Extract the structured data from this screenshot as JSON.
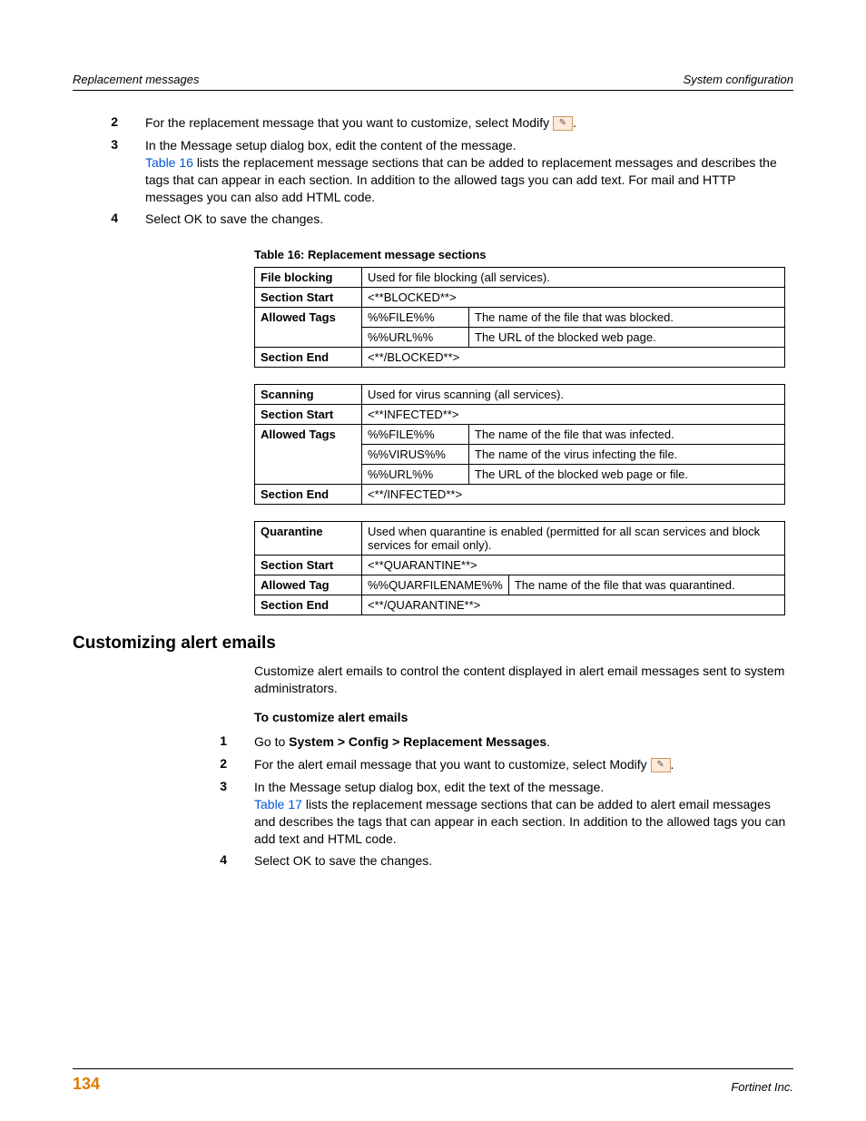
{
  "header": {
    "left": "Replacement messages",
    "right": "System configuration"
  },
  "steps_a": [
    {
      "num": "2",
      "prefix": "For the replacement message that you want to customize, select Modify ",
      "icon": "modify-icon"
    },
    {
      "num": "3",
      "lines": [
        "In the Message setup dialog box, edit the content of the message."
      ],
      "link": "Table 16",
      "after_link": " lists the replacement message sections that can be added to replacement messages and describes the tags that can appear in each section. In addition to the allowed tags you can add text. For mail and HTTP messages you can also add HTML code."
    },
    {
      "num": "4",
      "text": "Select OK to save the changes."
    }
  ],
  "table_caption": "Table 16: Replacement message sections",
  "tables": {
    "file_blocking": {
      "title": "File blocking",
      "desc": "Used for file blocking (all services).",
      "section_start_label": "Section Start",
      "section_start": "<**BLOCKED**>",
      "allowed_label": "Allowed Tags",
      "tags": [
        {
          "tag": "%%FILE%%",
          "desc": "The name of the file that was blocked."
        },
        {
          "tag": "%%URL%%",
          "desc": "The URL of the blocked web page."
        }
      ],
      "section_end_label": "Section End",
      "section_end": "<**/BLOCKED**>"
    },
    "scanning": {
      "title": "Scanning",
      "desc": "Used for virus scanning (all services).",
      "section_start_label": "Section Start",
      "section_start": "<**INFECTED**>",
      "allowed_label": "Allowed Tags",
      "tags": [
        {
          "tag": "%%FILE%%",
          "desc": "The name of the file that was infected."
        },
        {
          "tag": "%%VIRUS%%",
          "desc": "The name of the virus infecting the file."
        },
        {
          "tag": "%%URL%%",
          "desc": "The URL of the blocked web page or file."
        }
      ],
      "section_end_label": "Section End",
      "section_end": "<**/INFECTED**>"
    },
    "quarantine": {
      "title": "Quarantine",
      "desc": "Used when quarantine is enabled (permitted for all scan services and block services for email only).",
      "section_start_label": "Section Start",
      "section_start": "<**QUARANTINE**>",
      "allowed_label": "Allowed Tag",
      "tags": [
        {
          "tag": "%%QUARFILENAME%%",
          "desc": "The name of the file that was quarantined."
        }
      ],
      "section_end_label": "Section End",
      "section_end": "<**/QUARANTINE**>"
    }
  },
  "h2": "Customizing alert emails",
  "para_b": "Customize alert emails to control the content displayed in alert email messages sent to system administrators.",
  "h3": "To customize alert emails",
  "steps_b": [
    {
      "num": "1",
      "prefix": "Go to ",
      "nav": "System > Config > Replacement Messages",
      "suffix": "."
    },
    {
      "num": "2",
      "prefix": "For the alert email message that you want to customize, select Modify ",
      "icon": "modify-icon"
    },
    {
      "num": "3",
      "lines": [
        "In the Message setup dialog box, edit the text of the message."
      ],
      "link": "Table 17",
      "after_link": " lists the replacement message sections that can be added to alert email messages and describes the tags that can appear in each section. In addition to the allowed tags you can add text and HTML code."
    },
    {
      "num": "4",
      "text": "Select OK to save the changes."
    }
  ],
  "footer": {
    "page": "134",
    "right": "Fortinet Inc."
  }
}
